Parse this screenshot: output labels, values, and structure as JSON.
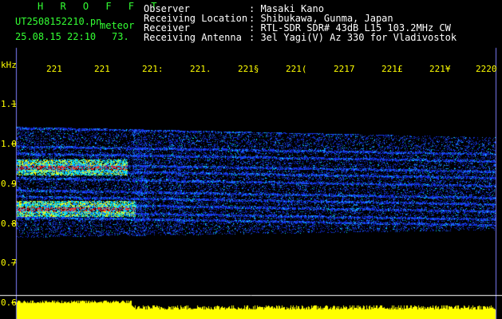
{
  "app": {
    "title": "H R O F F T",
    "file_name": "UT2508152210.pn",
    "file_suffix": "meteor",
    "datetime": "25.08.15 22:10",
    "count": "73."
  },
  "info": {
    "rows": [
      {
        "label": "Observer",
        "value": ": Masaki Kano"
      },
      {
        "label": "Receiving Location",
        "value": ": Shibukawa, Gunma, Japan"
      },
      {
        "label": "Receiver",
        "value": ": RTL-SDR SDR# 43dB L15 103.2MHz CW"
      },
      {
        "label": "Receiving Antenna",
        "value": ": 3el Yagi(V) Az 330 for Vladivostok"
      }
    ]
  },
  "axis": {
    "unit": "kHz",
    "x_ticks": [
      "221",
      "221",
      "221:",
      "221.",
      "221§",
      "221(",
      "2217",
      "221£",
      "221¥",
      "2220"
    ],
    "y_ticks": [
      "1.1",
      "1.0",
      "0.9",
      "0.8",
      "0.7",
      "0.6"
    ]
  },
  "colors": {
    "background": "#000000",
    "header_text": "#ffffff",
    "accent_green": "#33ff33",
    "axis_yellow": "#ffff00",
    "signal_blue": "#1a3cff",
    "signal_cyan": "#00ffff",
    "signal_red": "#ff2020"
  }
}
